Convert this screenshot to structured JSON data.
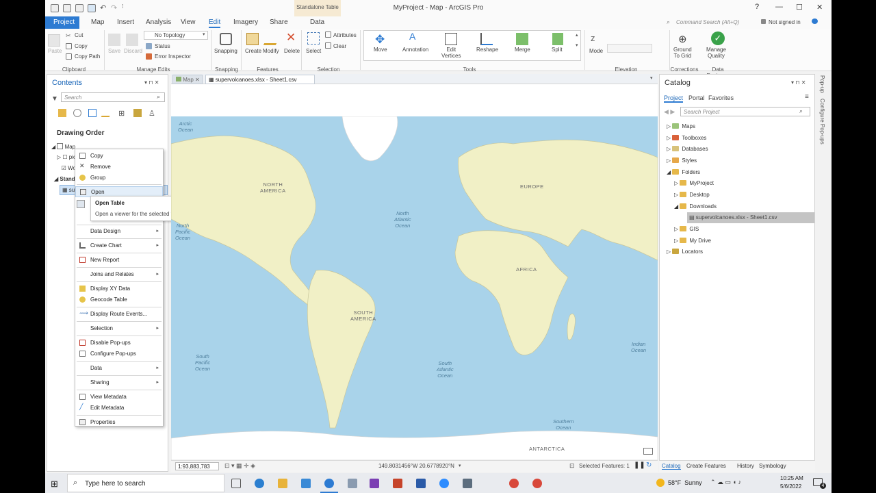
{
  "window": {
    "title": "MyProject - Map - ArcGIS Pro",
    "contextual_tab_group": "Standalone Table",
    "command_search_placeholder": "Command Search (Alt+Q)",
    "signin": "Not signed in",
    "help": "?",
    "minimize": "—",
    "maximize": "☐",
    "close": "✕"
  },
  "ribbon_tabs": [
    "Project",
    "Map",
    "Insert",
    "Analysis",
    "View",
    "Edit",
    "Imagery",
    "Share",
    "Data"
  ],
  "ribbon": {
    "clipboard": {
      "paste": "Paste",
      "cut": "Cut",
      "copy": "Copy",
      "copy_path": "Copy Path",
      "group": "Clipboard"
    },
    "manage_edits": {
      "save": "Save",
      "discard": "Discard",
      "topology": "No Topology",
      "status": "Status",
      "error_inspector": "Error Inspector",
      "group": "Manage Edits"
    },
    "snapping": {
      "label": "Snapping",
      "group": "Snapping"
    },
    "features": {
      "create": "Create",
      "modify": "Modify",
      "delete": "Delete",
      "group": "Features"
    },
    "selection": {
      "select": "Select",
      "attributes": "Attributes",
      "clear": "Clear",
      "group": "Selection"
    },
    "tools": {
      "move": "Move",
      "annotation": "Annotation",
      "edit_vertices": "Edit\nVertices",
      "reshape": "Reshape",
      "merge": "Merge",
      "split": "Split",
      "group": "Tools"
    },
    "elevation": {
      "mode": "Mode",
      "group": "Elevation"
    },
    "corrections": {
      "ground_to_grid": "Ground\nTo Grid",
      "group": "Corrections"
    },
    "data_reviewer": {
      "manage_quality": "Manage\nQuality",
      "group": "Data Reviewer"
    }
  },
  "contents": {
    "title": "Contents",
    "search_placeholder": "Search",
    "drawing_order": "Drawing Order",
    "rows": [
      "Map",
      "pic",
      "Wo",
      "Standa",
      "su"
    ]
  },
  "context_menu": {
    "items": [
      {
        "label": "Copy",
        "icon": "copy-icon"
      },
      {
        "label": "Remove",
        "icon": "remove-icon"
      },
      {
        "label": "Group",
        "icon": "group-icon"
      },
      {
        "label": "Open",
        "icon": "table-icon"
      },
      {
        "label": "Data Design",
        "icon": "",
        "submenu": true
      },
      {
        "label": "Create Chart",
        "icon": "chart-icon",
        "submenu": true
      },
      {
        "label": "New Report",
        "icon": "report-icon"
      },
      {
        "label": "Joins and Relates",
        "icon": "",
        "submenu": true
      },
      {
        "label": "Display XY Data",
        "icon": "xy-icon"
      },
      {
        "label": "Geocode Table",
        "icon": "geocode-icon"
      },
      {
        "label": "Display Route Events...",
        "icon": "route-icon"
      },
      {
        "label": "Selection",
        "icon": "",
        "submenu": true
      },
      {
        "label": "Disable Pop-ups",
        "icon": "popup-icon"
      },
      {
        "label": "Configure Pop-ups",
        "icon": "popup-icon"
      },
      {
        "label": "Data",
        "icon": "",
        "submenu": true
      },
      {
        "label": "Sharing",
        "icon": "",
        "submenu": true
      },
      {
        "label": "View Metadata",
        "icon": "metadata-icon"
      },
      {
        "label": "Edit Metadata",
        "icon": "pencil-icon"
      },
      {
        "label": "Properties",
        "icon": "properties-icon"
      }
    ],
    "tooltip_title": "Open Table",
    "tooltip_text": "Open a viewer for the selected table."
  },
  "doc_tabs": {
    "map": "Map",
    "table": "supervolcanoes.xlsx - Sheet1.csv"
  },
  "map": {
    "continents": [
      "NORTH\nAMERICA",
      "SOUTH\nAMERICA",
      "EUROPE",
      "AFRICA",
      "ANTARCTICA"
    ],
    "oceans": [
      "Arctic\nOcean",
      "North\nAtlantic\nOcean",
      "North\nPacific\nOcean",
      "South\nPacific\nOcean",
      "South\nAtlantic\nOcean",
      "Indian\nOcean",
      "Southern\nOcean"
    ],
    "colors": {
      "ocean": "#a9d3ea",
      "land": "#f1f0c6",
      "ice": "#ffffff"
    }
  },
  "map_status": {
    "scale": "1:93,883,783",
    "coordinates": "149.8031456°W 20.6778920°N",
    "selected_features": "Selected Features: 1"
  },
  "catalog": {
    "title": "Catalog",
    "tabs": [
      "Project",
      "Portal",
      "Favorites"
    ],
    "search_placeholder": "Search Project",
    "items": [
      "Maps",
      "Toolboxes",
      "Databases",
      "Styles",
      "Folders",
      "MyProject",
      "Desktop",
      "Downloads",
      "supervolcanoes.xlsx - Sheet1.csv",
      "GIS",
      "My Drive",
      "Locators"
    ],
    "bottom_tabs": [
      "Catalog",
      "Create Features",
      "History",
      "Symbology"
    ],
    "side_tabs": [
      "Pop-up",
      "Configure Pop-ups"
    ]
  },
  "taskbar": {
    "search_placeholder": "Type here to search",
    "weather": "58°F  Sunny",
    "time": "10:25 AM",
    "date": "5/6/2022",
    "notifications": "4"
  }
}
